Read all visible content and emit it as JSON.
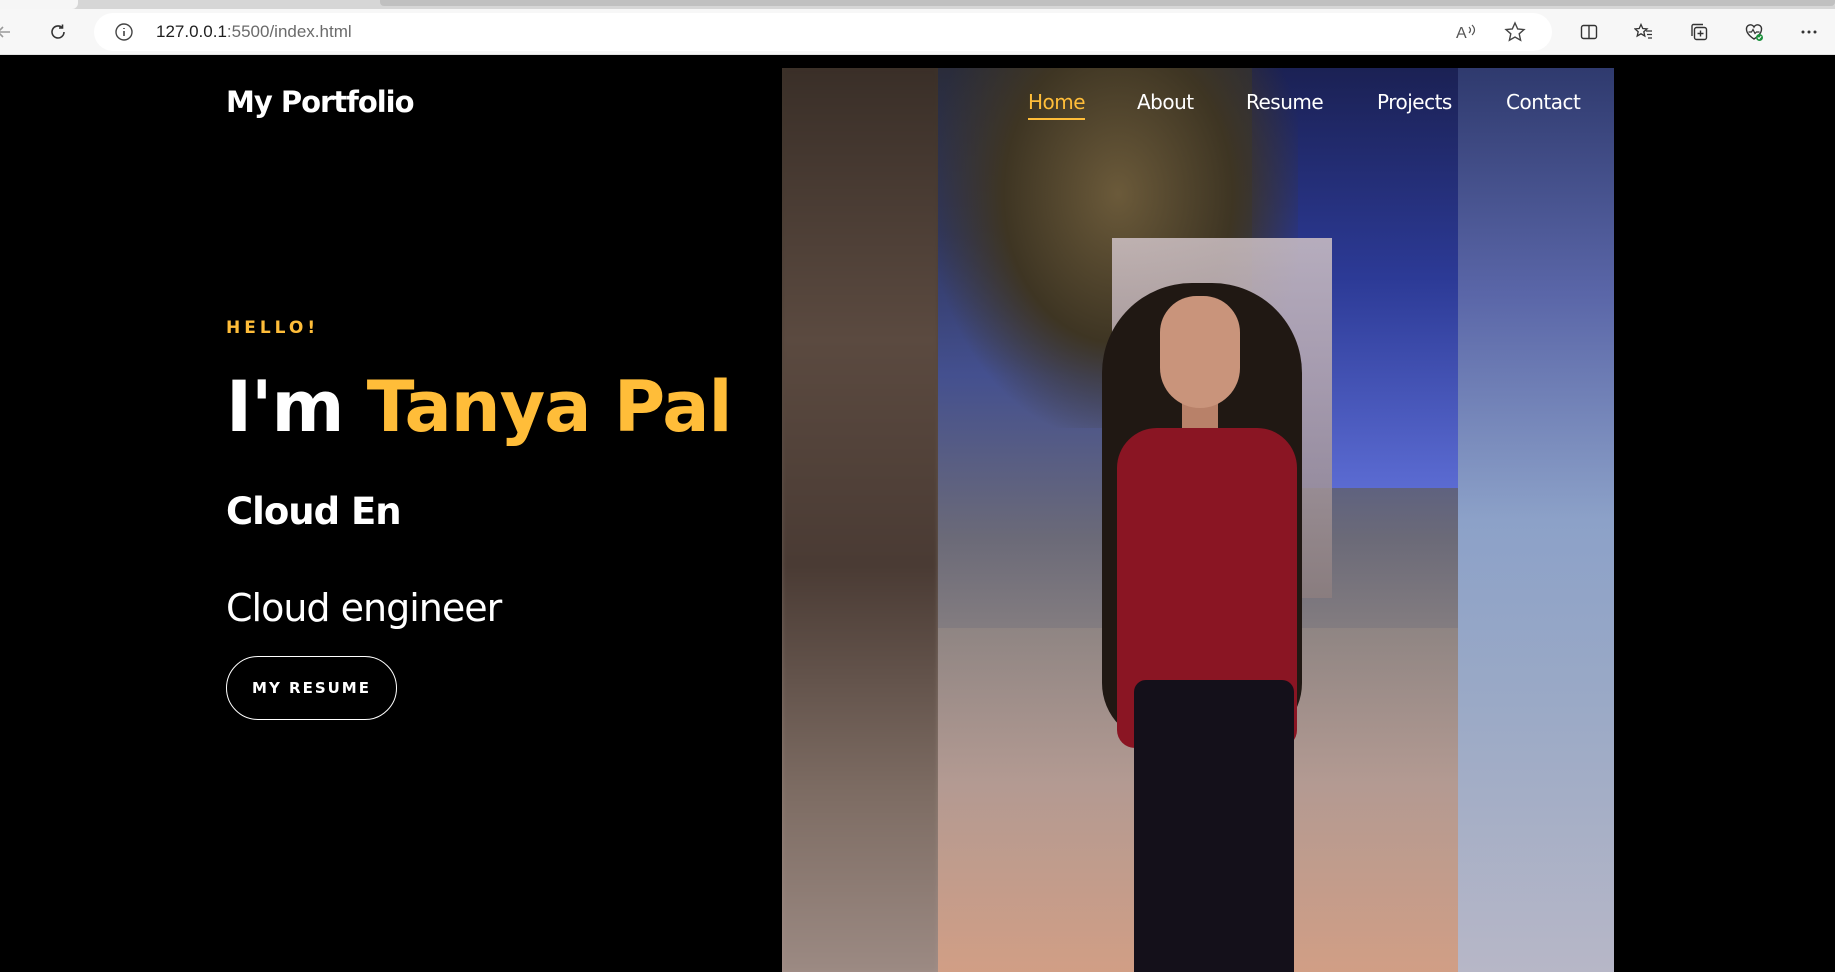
{
  "browser": {
    "url_host": "127.0.0.1",
    "url_rest": ":5500/index.html"
  },
  "site": {
    "brand": "My Portfolio",
    "nav": [
      "Home",
      "About",
      "Resume",
      "Projects",
      "Contact"
    ],
    "active_nav": "Home",
    "accent_color": "#ffbd39"
  },
  "hero": {
    "greeting": "HELLO!",
    "title_prefix": "I'm",
    "name": "Tanya Pal",
    "typed_text": "Cloud En",
    "role": "Cloud engineer",
    "button_label": "MY RESUME"
  }
}
